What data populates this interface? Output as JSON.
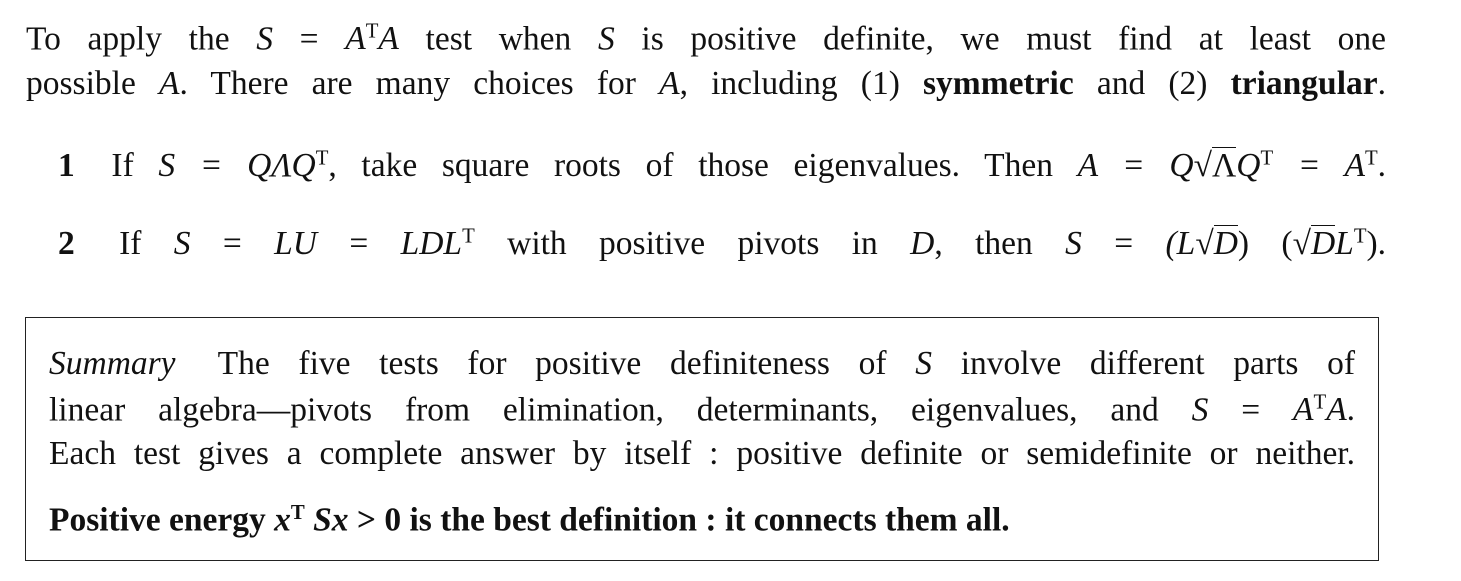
{
  "intro": {
    "line1": {
      "a": "To apply the",
      "S": "S",
      "eq": "=",
      "A": "A",
      "T": "T",
      "A2": "A",
      "b": "test when",
      "S2": "S",
      "c": "is positive definite, we must find at least one"
    },
    "line2": {
      "a": "possible",
      "A": "A",
      "b": ". There are many choices for",
      "A2": "A",
      "c": ", including (1)",
      "sym": "symmetric",
      "d": "and (2)",
      "tri": "triangular",
      "e": "."
    }
  },
  "items": [
    {
      "num": "1",
      "if": "If",
      "lhs": "S = QΛQ",
      "T": "T",
      "mid": ", take square roots of those eigenvalues.  Then",
      "A": "A = Q",
      "root": "Λ",
      "Q": "Q",
      "T2": "T",
      "eq": "= A",
      "T3": "T",
      "end": "."
    },
    {
      "num": "2",
      "if": "If",
      "S": "S",
      "eq1": "=",
      "LU": "LU",
      "eq2": "=",
      "LDL": "LDL",
      "T": "T",
      "mid": "with positive pivots in",
      "D": "D",
      "then": ", then",
      "S2": "S",
      "eq3": "=",
      "p1": "(L",
      "rootD": "D",
      "p2": ") (",
      "rootD2": "D",
      "L": "L",
      "T2": "T",
      "end": ")."
    }
  ],
  "summary": {
    "label": "Summary",
    "line1": {
      "a": "The five tests for positive definiteness of",
      "S": "S",
      "b": "involve different parts of"
    },
    "line2": {
      "a": "linear algebra—pivots from elimination, determinants, eigenvalues, and",
      "S": "S",
      "eq": "=",
      "A": "A",
      "T": "T",
      "A2": "A",
      "end": "."
    },
    "line3": "Each test gives a complete answer by itself : positive definite or semidefinite or neither.",
    "line4": {
      "a": "Positive energy",
      "x": "x",
      "T": "T",
      "Sx": "Sx",
      "gt": ">",
      "b": "0 is the best definition : it connects them all."
    }
  }
}
